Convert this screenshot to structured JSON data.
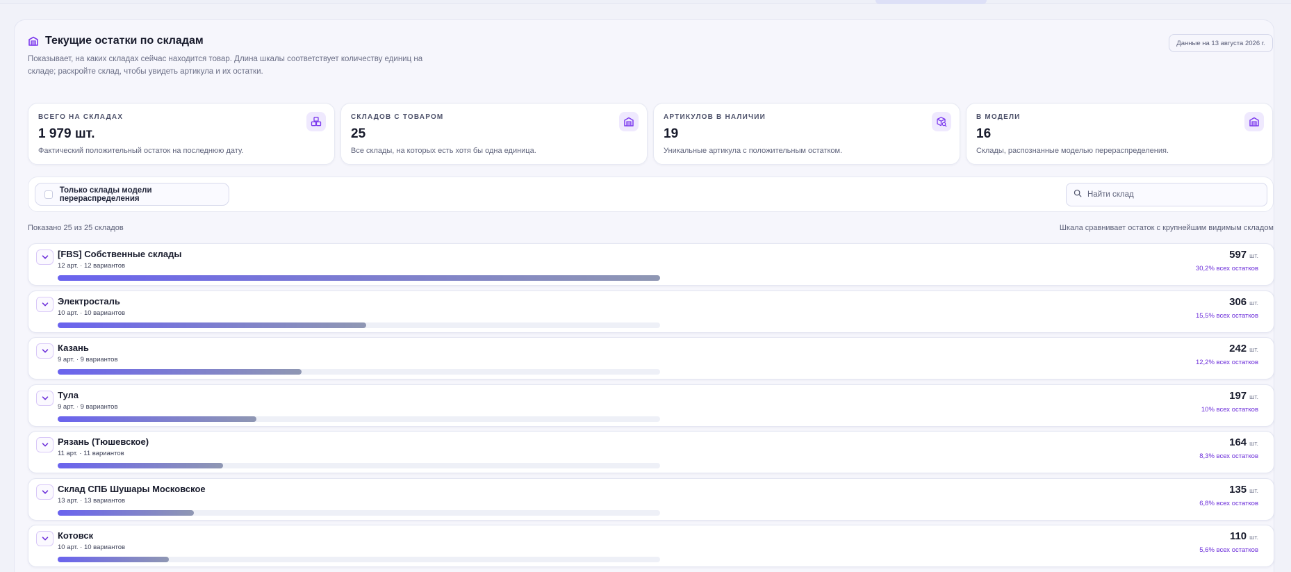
{
  "header": {
    "title": "Текущие остатки по складам",
    "description": "Показывает, на каких складах сейчас находится товар. Длина шкалы соответствует количеству единиц на складе; раскройте склад, чтобы увидеть артикула и их остатки.",
    "date_badge": "Данные на 13 августа 2026 г."
  },
  "stats": [
    {
      "label": "ВСЕГО НА СКЛАДАХ",
      "value": "1 979 шт.",
      "desc": "Фактический положительный остаток на последнюю дату.",
      "icon": "boxes-icon"
    },
    {
      "label": "СКЛАДОВ С ТОВАРОМ",
      "value": "25",
      "desc": "Все склады, на которых есть хотя бы одна единица.",
      "icon": "warehouse-icon"
    },
    {
      "label": "АРТИКУЛОВ В НАЛИЧИИ",
      "value": "19",
      "desc": "Уникальные артикула с положительным остатком.",
      "icon": "package-search-icon"
    },
    {
      "label": "В МОДЕЛИ",
      "value": "16",
      "desc": "Склады, распознанные моделью перераспределения.",
      "icon": "warehouse-icon"
    }
  ],
  "filters": {
    "model_only_label": "Только склады модели перераспределения",
    "model_only_checked": false,
    "search_placeholder": "Найти склад",
    "search_value": ""
  },
  "list": {
    "shown_text": "Показано 25 из 25 складов",
    "scale_note": "Шкала сравнивает остаток с крупнейшим видимым складом",
    "unit": "шт.",
    "warehouses": [
      {
        "name": "[FBS] Собственные склады",
        "meta": "12 арт. · 12 вариантов",
        "qty": "597",
        "qty_num": 597,
        "share": "30,2% всех остатков"
      },
      {
        "name": "Электросталь",
        "meta": "10 арт. · 10 вариантов",
        "qty": "306",
        "qty_num": 306,
        "share": "15,5% всех остатков"
      },
      {
        "name": "Казань",
        "meta": "9 арт. · 9 вариантов",
        "qty": "242",
        "qty_num": 242,
        "share": "12,2% всех остатков"
      },
      {
        "name": "Тула",
        "meta": "9 арт. · 9 вариантов",
        "qty": "197",
        "qty_num": 197,
        "share": "10% всех остатков"
      },
      {
        "name": "Рязань (Тюшевское)",
        "meta": "11 арт. · 11 вариантов",
        "qty": "164",
        "qty_num": 164,
        "share": "8,3% всех остатков"
      },
      {
        "name": "Склад СПБ Шушары Московское",
        "meta": "13 арт. · 13 вариантов",
        "qty": "135",
        "qty_num": 135,
        "share": "6,8% всех остатков"
      },
      {
        "name": "Котовск",
        "meta": "10 арт. · 10 вариантов",
        "qty": "110",
        "qty_num": 110,
        "share": "5,6% всех остатков"
      }
    ]
  },
  "colors": {
    "accent": "#6a2bd9",
    "icon_bg": "#efe9fe",
    "bar_start": "#6a63ee",
    "bar_end": "#8f97b3"
  }
}
